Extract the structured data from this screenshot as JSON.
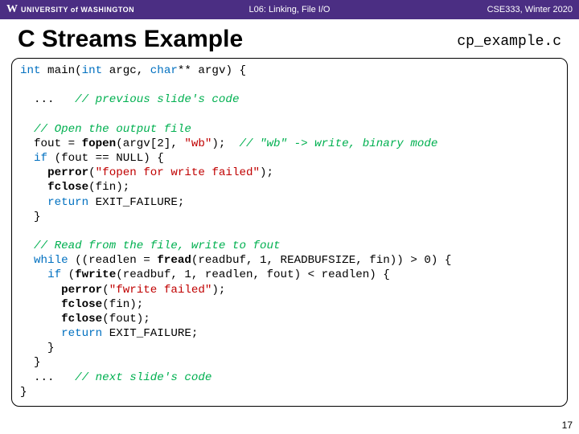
{
  "header": {
    "university_glyph": "W",
    "university_text": "UNIVERSITY of WASHINGTON",
    "lecture": "L06: Linking, File I/O",
    "course": "CSE333, Winter 2020"
  },
  "title": "C Streams Example",
  "filename": "cp_example.c",
  "code": {
    "l01_a": "int",
    "l01_b": " main(",
    "l01_c": "int",
    "l01_d": " argc, ",
    "l01_e": "char",
    "l01_f": "** argv) {",
    "l02": "",
    "l03_a": "  ...   ",
    "l03_b": "// previous slide's code",
    "l04": "",
    "l05_a": "  ",
    "l05_b": "// Open the output file",
    "l06_a": "  fout = ",
    "l06_b": "fopen",
    "l06_c": "(argv[2], ",
    "l06_d": "\"wb\"",
    "l06_e": ");  ",
    "l06_f": "// \"wb\" -> write, binary mode",
    "l07_a": "  ",
    "l07_b": "if",
    "l07_c": " (fout == NULL) {",
    "l08_a": "    ",
    "l08_b": "perror",
    "l08_c": "(",
    "l08_d": "\"fopen for write failed\"",
    "l08_e": ");",
    "l09_a": "    ",
    "l09_b": "fclose",
    "l09_c": "(fin);",
    "l10_a": "    ",
    "l10_b": "return",
    "l10_c": " EXIT_FAILURE;",
    "l11": "  }",
    "l12": "",
    "l13_a": "  ",
    "l13_b": "// Read from the file, write to fout",
    "l14_a": "  ",
    "l14_b": "while",
    "l14_c": " ((readlen = ",
    "l14_d": "fread",
    "l14_e": "(readbuf, 1, READBUFSIZE, fin)) > 0) {",
    "l15_a": "    ",
    "l15_b": "if",
    "l15_c": " (",
    "l15_d": "fwrite",
    "l15_e": "(readbuf, 1, readlen, fout) < readlen) {",
    "l16_a": "      ",
    "l16_b": "perror",
    "l16_c": "(",
    "l16_d": "\"fwrite failed\"",
    "l16_e": ");",
    "l17_a": "      ",
    "l17_b": "fclose",
    "l17_c": "(fin);",
    "l18_a": "      ",
    "l18_b": "fclose",
    "l18_c": "(fout);",
    "l19_a": "      ",
    "l19_b": "return",
    "l19_c": " EXIT_FAILURE;",
    "l20": "    }",
    "l21": "  }",
    "l22_a": "  ...   ",
    "l22_b": "// next slide's code",
    "l23": "}"
  },
  "page_number": "17"
}
